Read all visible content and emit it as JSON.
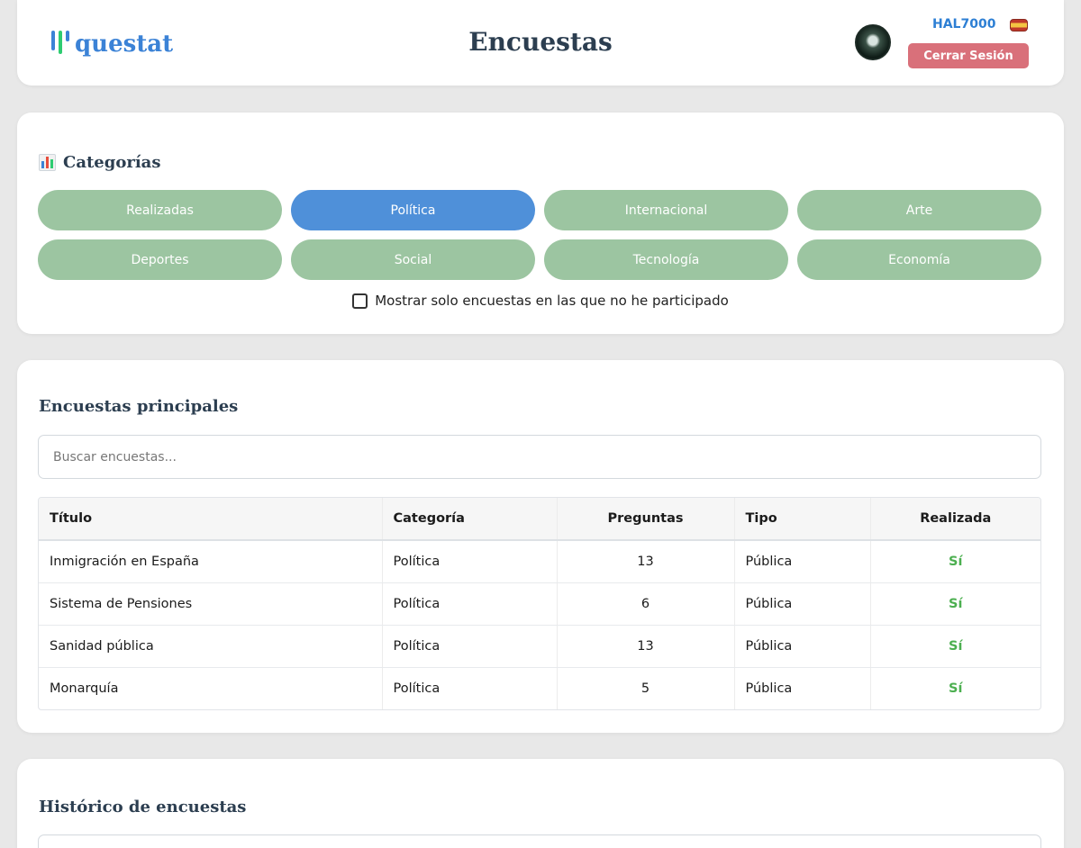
{
  "header": {
    "logo_text": "questat",
    "logo_bar_colors": [
      "#3b82d6",
      "#2ecc71",
      "#3b82d6"
    ],
    "title": "Encuestas",
    "username": "HAL7000",
    "logout_label": "Cerrar Sesión",
    "logout_color": "#d9707a"
  },
  "categories": {
    "heading": "Categorías",
    "items": [
      {
        "label": "Realizadas",
        "active": false
      },
      {
        "label": "Política",
        "active": true
      },
      {
        "label": "Internacional",
        "active": false
      },
      {
        "label": "Arte",
        "active": false
      },
      {
        "label": "Deportes",
        "active": false
      },
      {
        "label": "Social",
        "active": false
      },
      {
        "label": "Tecnología",
        "active": false
      },
      {
        "label": "Economía",
        "active": false
      }
    ],
    "filter_label": "Mostrar solo encuestas en las que no he participado",
    "filter_checked": false,
    "colors": {
      "inactive": "#9cc5a1",
      "active": "#4f90d9"
    }
  },
  "main": {
    "heading": "Encuestas principales",
    "search_placeholder": "Buscar encuestas...",
    "columns": [
      "Título",
      "Categoría",
      "Preguntas",
      "Tipo",
      "Realizada"
    ],
    "rows": [
      [
        "Inmigración en España",
        "Política",
        "13",
        "Pública",
        "Sí"
      ],
      [
        "Sistema de Pensiones",
        "Política",
        "6",
        "Pública",
        "Sí"
      ],
      [
        "Sanidad pública",
        "Política",
        "13",
        "Pública",
        "Sí"
      ],
      [
        "Monarquía",
        "Política",
        "5",
        "Pública",
        "Sí"
      ]
    ]
  },
  "history": {
    "heading": "Histórico de encuestas"
  }
}
